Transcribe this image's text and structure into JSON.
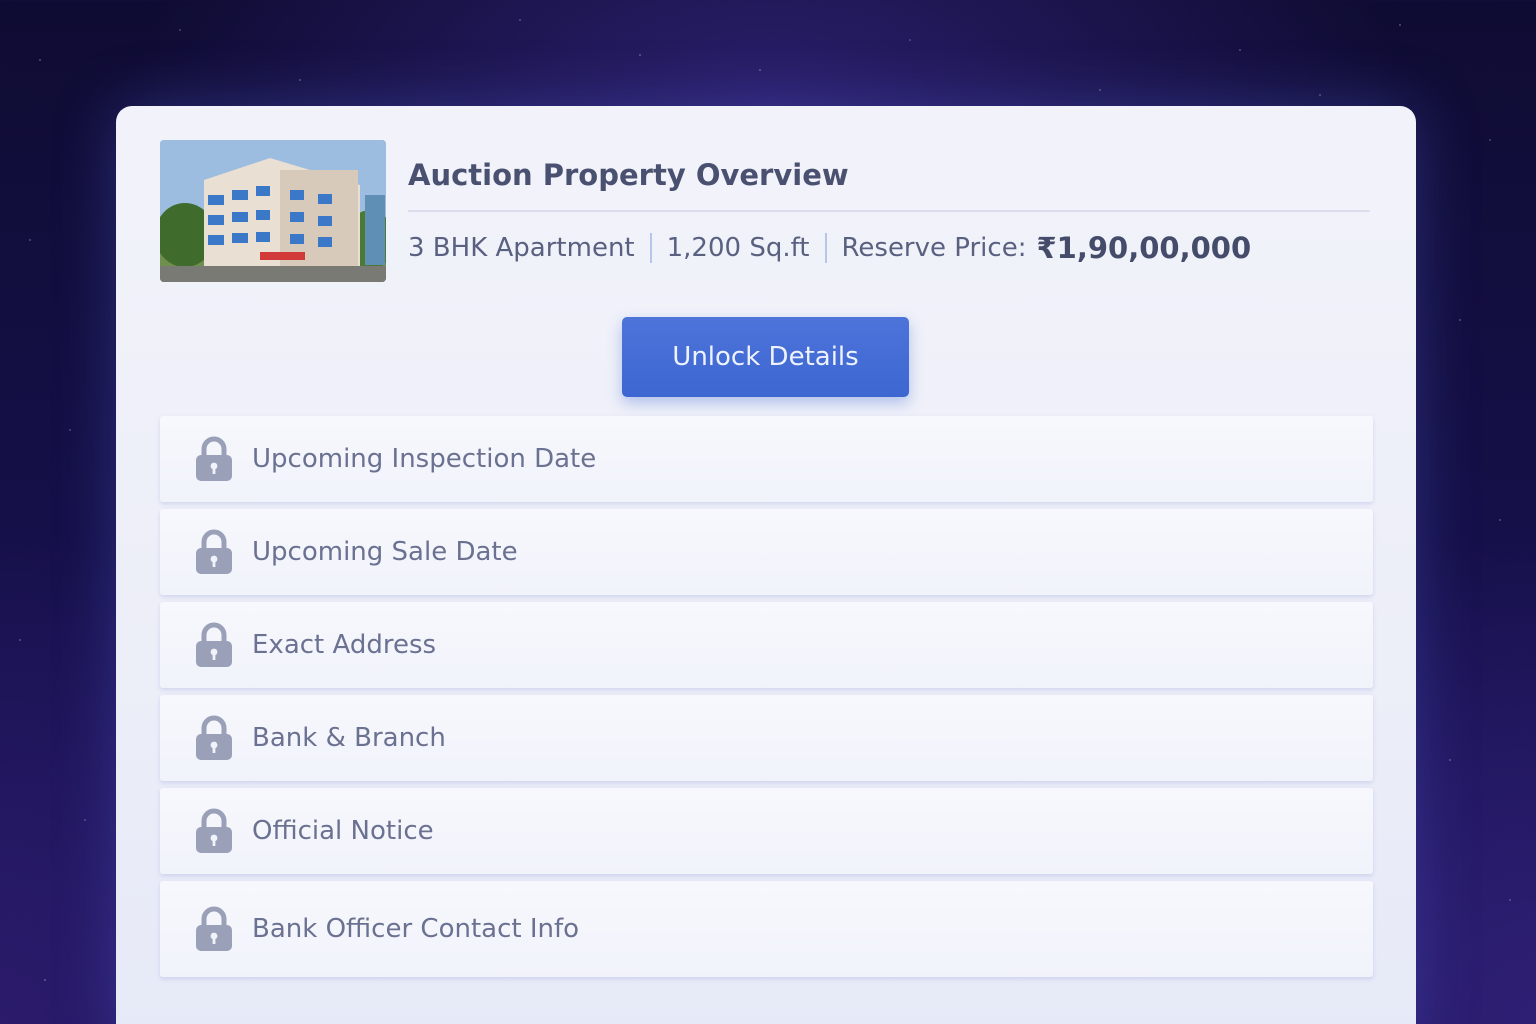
{
  "card": {
    "title": "Auction Property Overview",
    "property_type": "3 BHK Apartment",
    "area": "1,200 Sq.ft",
    "reserve_price_label": "Reserve Price:",
    "reserve_price": "₹1,90,00,000",
    "thumbnail_icon": "apartment-building-photo"
  },
  "unlock_button": {
    "label": "Unlock Details"
  },
  "locked_items": [
    {
      "label": "Upcoming Inspection Date",
      "icon": "lock-icon"
    },
    {
      "label": "Upcoming Sale Date",
      "icon": "lock-icon"
    },
    {
      "label": "Exact Address",
      "icon": "lock-icon"
    },
    {
      "label": "Bank & Branch",
      "icon": "lock-icon"
    },
    {
      "label": "Official Notice",
      "icon": "lock-icon"
    },
    {
      "label": "Bank Officer Contact Info",
      "icon": "lock-icon"
    }
  ],
  "colors": {
    "accent": "#3d66d2",
    "locked_text": "#6b7191",
    "lock_icon": "#9aa0b8",
    "background": "#151048"
  }
}
